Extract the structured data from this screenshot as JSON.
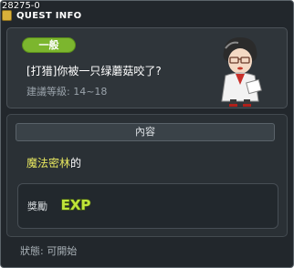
{
  "window": {
    "quest_id": "28275-0",
    "title": "QUEST INFO"
  },
  "quest": {
    "category": "一般",
    "name": "[打猎]你被一只绿蘑菇咬了?",
    "level_text": "建議等級: 14~18"
  },
  "content": {
    "header": "內容",
    "map_name": "魔法密林",
    "map_suffix": "的"
  },
  "reward": {
    "label": "獎勵",
    "exp_text": "EXP"
  },
  "status": {
    "text": "狀態: 可開始"
  },
  "colors": {
    "window_bg": "#22272c",
    "category_badge": "#7cb62e",
    "map_name": "#e8e860",
    "exp_icon": "#bfe43a"
  },
  "icons": {
    "title_icon": "quest-scroll-icon",
    "npc": "npc-portrait",
    "exp": "exp-icon"
  }
}
